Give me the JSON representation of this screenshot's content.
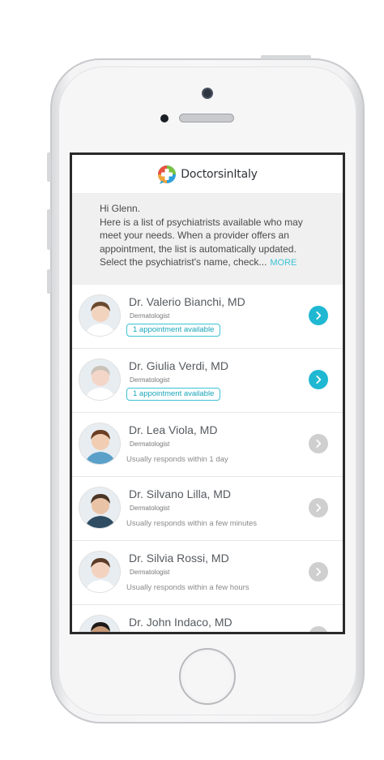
{
  "app": {
    "logo_text": "DoctorsinItaly",
    "brand_colors": {
      "accent": "#1fb8d2",
      "logo_green": "#7ac143",
      "logo_red": "#e8523f",
      "logo_blue": "#2d9fd8"
    }
  },
  "intro": {
    "greeting": "Hi Glenn.",
    "message": "Here is a list of psychiatrists available who may meet your needs. When a provider offers an appointment, the list is automatically updated. Select the psychiatrist's name, check...",
    "more_label": "MORE"
  },
  "doctors": [
    {
      "name": "Dr. Valerio Bianchi, MD",
      "specialty": "Dermatologist",
      "status": "1 appointment available",
      "status_type": "badge",
      "chevron": "active",
      "avatar_icon": "doctor-avatar"
    },
    {
      "name": "Dr. Giulia Verdi, MD",
      "specialty": "Dermatologist",
      "status": "1 appointment available",
      "status_type": "badge",
      "chevron": "active",
      "avatar_icon": "doctor-avatar"
    },
    {
      "name": "Dr. Lea Viola, MD",
      "specialty": "Dermatologist",
      "status": "Usually responds within 1 day",
      "status_type": "text",
      "chevron": "inactive",
      "avatar_icon": "doctor-avatar"
    },
    {
      "name": "Dr. Silvano Lilla, MD",
      "specialty": "Dermatologist",
      "status": "Usually responds within a few minutes",
      "status_type": "text",
      "chevron": "inactive",
      "avatar_icon": "doctor-avatar"
    },
    {
      "name": "Dr. Silvia Rossi, MD",
      "specialty": "Dermatologist",
      "status": "Usually responds within a few hours",
      "status_type": "text",
      "chevron": "inactive",
      "avatar_icon": "doctor-avatar"
    },
    {
      "name": "Dr. John Indaco, MD",
      "specialty": "",
      "status": "",
      "status_type": "none",
      "chevron": "inactive",
      "avatar_icon": "doctor-avatar"
    }
  ]
}
